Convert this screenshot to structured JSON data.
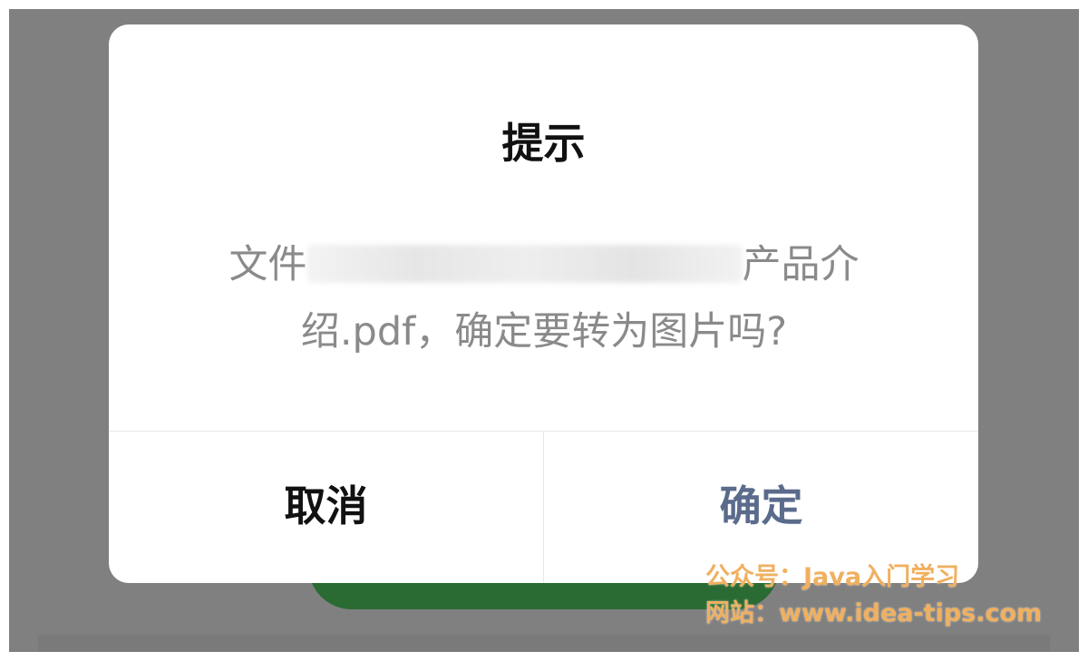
{
  "dialog": {
    "title": "提示",
    "message_prefix": "文件",
    "message_suffix": "产品介",
    "message_line2": "绍.pdf，确定要转为图片吗?",
    "cancel_label": "取消",
    "confirm_label": "确定"
  },
  "watermark": {
    "line1": "公众号：Java入门学习",
    "line2": "网站：www.idea-tips.com"
  },
  "colors": {
    "overlay": "#808080",
    "dialog_bg": "#ffffff",
    "title_text": "#111111",
    "message_text": "#8a8a8a",
    "confirm_text": "#5a6b8c",
    "underlying_button": "#2a6a33",
    "watermark_text": "#f0b060"
  }
}
